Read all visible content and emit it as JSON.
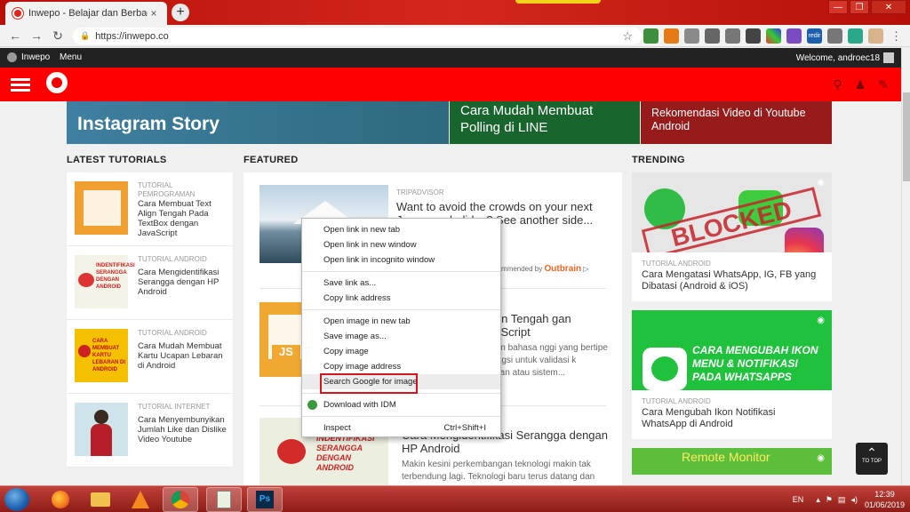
{
  "browser": {
    "tab_title": "Inwepo - Belajar dan Berbagi Tut",
    "tab_close": "×",
    "new_tab": "+",
    "url": "https://inwepo.co",
    "back": "←",
    "forward": "→",
    "reload": "↻",
    "star": "☆",
    "menu": "⋮",
    "ext_redir_label": "redir",
    "win_min": "—",
    "win_max": "❐",
    "win_close": "✕"
  },
  "site": {
    "brand": "Inwepo",
    "menu": "Menu",
    "welcome": "Welcome, androec18",
    "slides": [
      {
        "title": "Instagram Story"
      },
      {
        "title": "Cara Mudah Membuat Polling di LINE"
      },
      {
        "title": "Rekomendasi Video di Youtube Android"
      }
    ],
    "sections": {
      "latest": "LATEST TUTORIALS",
      "featured": "FEATURED",
      "trending": "TRENDING"
    },
    "latest": [
      {
        "category": "TUTORIAL PEMROGRAMAN",
        "title": "Cara Membuat Text Align Tengah Pada TextBox dengan JavaScript"
      },
      {
        "category": "TUTORIAL ANDROID",
        "title": "Cara Mengidentifikasi Serangga dengan HP Android"
      },
      {
        "category": "TUTORIAL ANDROID",
        "title": "Cara Mudah Membuat Kartu Ucapan Lebaran di Android"
      },
      {
        "category": "TUTORIAL INTERNET",
        "title": "Cara Menyembunyikan Jumlah Like dan Dislike Video Youtube"
      }
    ],
    "featured": [
      {
        "category": "TRIPADVISOR",
        "title": "Want to avoid the crowds on your next Japanese holiday? See another side...",
        "note": "mmended by",
        "outbrain": "Outbrain"
      },
      {
        "title": "t Align Tengah gan JavaScript",
        "desc": "upakan bahasa nggi yang bertipe berfungsi untuk validasi k tampilan atau sistem..."
      },
      {
        "title": "Cara Mengidentifikasi Serangga dengan HP Android",
        "desc": "Makin kesini perkembangan teknologi makin tak terbendung lagi. Teknologi baru terus datang dan"
      }
    ],
    "trending": [
      {
        "category": "TUTORIAL ANDROID",
        "title": "Cara Mengatasi WhatsApp, IG, FB yang Dibatasi (Android & iOS)",
        "stamp": "BLOCKED"
      },
      {
        "category": "TUTORIAL ANDROID",
        "title": "Cara Mengubah Ikon Notifikasi WhatsApp di Android",
        "img_text": "CARA MENGUBAH IKON MENU & NOTIFIKASI PADA WHATSAPPS"
      },
      {
        "img_text": "Remote Monitor"
      }
    ],
    "thumb_texts": {
      "serangga": "INDENTIFIKASI SERANGGA DENGAN ANDROID",
      "kartu": "CARA MEMBUAT KARTU LEBARAN DI ANDROID",
      "js": "JS"
    },
    "to_top": "TO TOP"
  },
  "context_menu": {
    "items": [
      "Open link in new tab",
      "Open link in new window",
      "Open link in incognito window",
      "Save link as...",
      "Copy link address",
      "Open image in new tab",
      "Save image as...",
      "Copy image",
      "Copy image address",
      "Search Google for image",
      "Download with IDM",
      "Inspect"
    ],
    "inspect_shortcut": "Ctrl+Shift+I"
  },
  "taskbar": {
    "lang": "EN",
    "time": "12:39",
    "date": "01/06/2019",
    "ps_label": "Ps"
  }
}
